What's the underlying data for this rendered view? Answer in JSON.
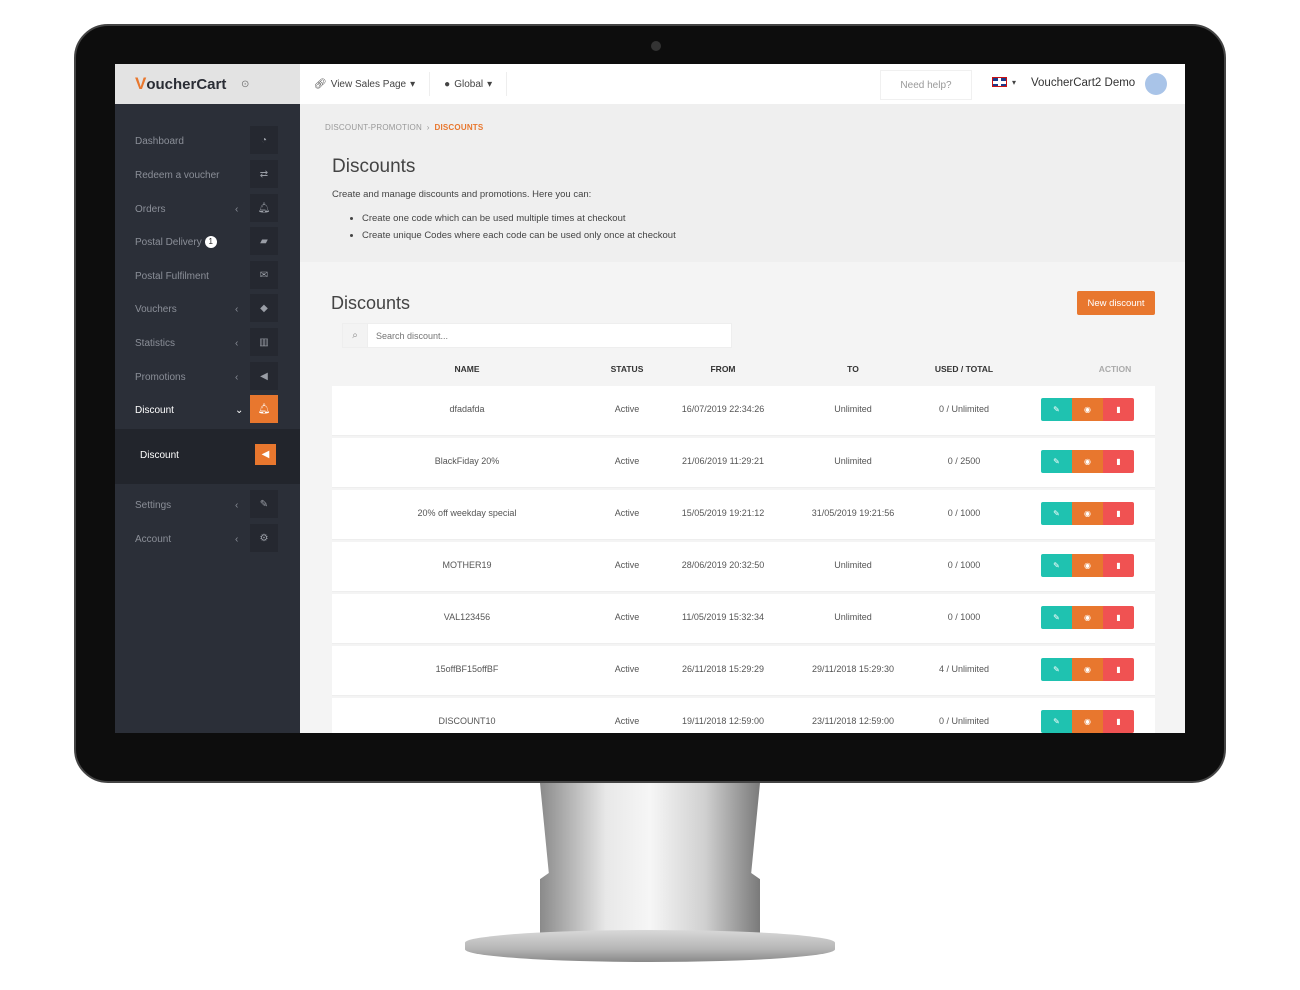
{
  "brand": {
    "logo_v": "V",
    "logo_rest": "oucherCart",
    "accent": "#e8772e"
  },
  "topbar": {
    "view_sales": "View Sales Page",
    "global": "Global",
    "help": "Need help?",
    "user": "VoucherCart2 Demo"
  },
  "sidebar": {
    "items": [
      {
        "label": "Dashboard",
        "icon": "dashboard-icon",
        "glyph": "◔"
      },
      {
        "label": "Redeem a voucher",
        "icon": "exchange-icon",
        "glyph": "⇄"
      },
      {
        "label": "Orders",
        "icon": "bell-icon",
        "glyph": "🔔︎",
        "chev": "‹"
      },
      {
        "label": "Postal Delivery",
        "icon": "truck-icon",
        "glyph": "▰",
        "badge": "1"
      },
      {
        "label": "Postal Fulfilment",
        "icon": "envelope-icon",
        "glyph": "✉"
      },
      {
        "label": "Vouchers",
        "icon": "tag-icon",
        "glyph": "◆",
        "chev": "‹"
      },
      {
        "label": "Statistics",
        "icon": "chart-icon",
        "glyph": "▥",
        "chev": "‹"
      },
      {
        "label": "Promotions",
        "icon": "bullhorn-icon",
        "glyph": "◀",
        "chev": "‹"
      },
      {
        "label": "Discount",
        "icon": "bell-icon",
        "glyph": "🔔︎",
        "chev": "⌄"
      },
      {
        "label": "Discount",
        "icon": "bullhorn-icon",
        "glyph": "◀"
      },
      {
        "label": "Settings",
        "icon": "wrench-icon",
        "glyph": "✎",
        "chev": "‹"
      },
      {
        "label": "Account",
        "icon": "cogs-icon",
        "glyph": "⚙",
        "chev": "‹"
      }
    ]
  },
  "header": {
    "crumb1": "DISCOUNT-PROMOTION",
    "crumb2": "DISCOUNTS",
    "title": "Discounts",
    "desc": "Create and manage discounts and promotions. Here you can:",
    "bullets": [
      "Create one code which can be used multiple times at checkout",
      "Create unique Codes where each code can be used only once at checkout"
    ]
  },
  "list": {
    "title": "Discounts",
    "new_button": "New discount",
    "search_placeholder": "Search discount...",
    "columns": [
      "NAME",
      "STATUS",
      "FROM",
      "TO",
      "USED / TOTAL",
      "ACTION"
    ],
    "rows": [
      [
        "dfadafda",
        "Active",
        "16/07/2019 22:34:26",
        "Unlimited",
        "0 / Unlimited"
      ],
      [
        "BlackFiday 20%",
        "Active",
        "21/06/2019 11:29:21",
        "Unlimited",
        "0 / 2500"
      ],
      [
        "20% off weekday special",
        "Active",
        "15/05/2019 19:21:12",
        "31/05/2019 19:21:56",
        "0 / 1000"
      ],
      [
        "MOTHER19",
        "Active",
        "28/06/2019 20:32:50",
        "Unlimited",
        "0 / 1000"
      ],
      [
        "VAL123456",
        "Active",
        "11/05/2019 15:32:34",
        "Unlimited",
        "0 / 1000"
      ],
      [
        "15offBF15offBF",
        "Active",
        "26/11/2018 15:29:29",
        "29/11/2018 15:29:30",
        "4 / Unlimited"
      ],
      [
        "DISCOUNT10",
        "Active",
        "19/11/2018 12:59:00",
        "23/11/2018 12:59:00",
        "0 / Unlimited"
      ]
    ]
  }
}
